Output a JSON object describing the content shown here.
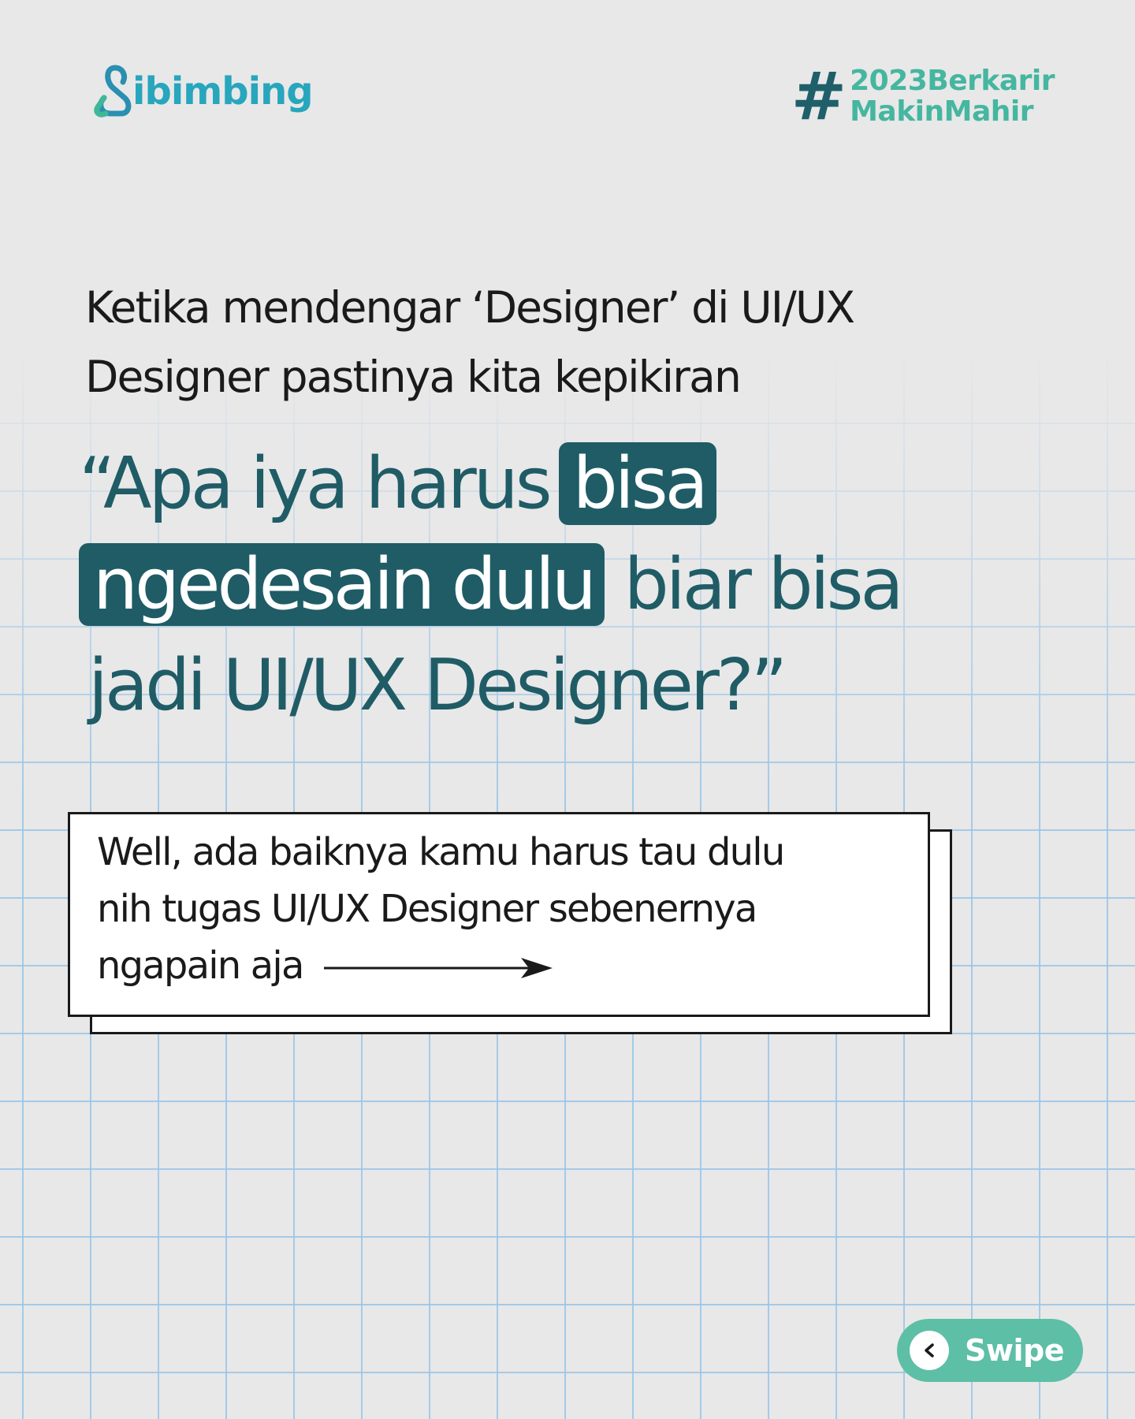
{
  "brand": {
    "logo_text": "ibimbing",
    "logo_icon": "ibimbing-mark-icon",
    "color_primary": "#27a6bd",
    "color_accent": "#45b6a0"
  },
  "hashtag": {
    "sign": "#",
    "line1": "2023Berkarir",
    "line2": "MakinMahir"
  },
  "intro": {
    "line1": "Ketika mendengar ‘Designer’ di UI/UX",
    "line2": "Designer pastinya kita kepikiran"
  },
  "quote": {
    "line1_text": "“Apa iya harus",
    "line1_highlight": "bisa",
    "line2_highlight": "ngedesain dulu",
    "line2_text": "biar bisa",
    "line3_text": "jadi UI/UX Designer?”",
    "color_text": "#1f5c66",
    "color_highlight_bg": "#1f5c66"
  },
  "card": {
    "line1": "Well, ada baiknya kamu harus tau dulu",
    "line2": "nih tugas UI/UX Designer sebenernya",
    "line3": "ngapain aja",
    "arrow_icon": "arrow-right-icon"
  },
  "swipe": {
    "label": "Swipe",
    "icon": "chevron-left-icon",
    "color": "#5dbfa5"
  }
}
